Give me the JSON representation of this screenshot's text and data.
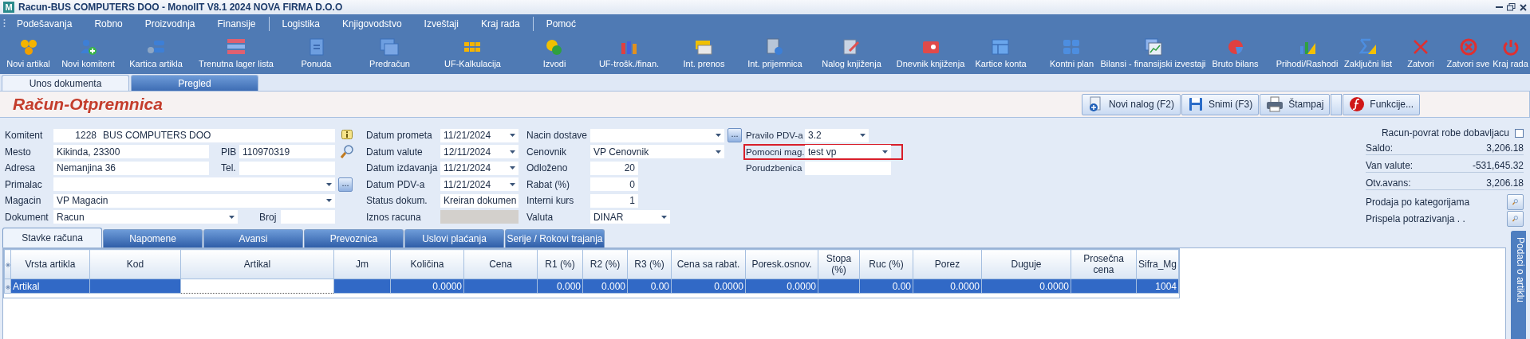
{
  "window": {
    "app_icon": "M",
    "title": "Racun-BUS COMPUTERS DOO - MonolIT V8.1 2024 NOVA FIRMA D.O.O"
  },
  "menu": [
    {
      "label": "Podešavanja",
      "separator_before": false
    },
    {
      "label": "Robno",
      "separator_before": false
    },
    {
      "label": "Proizvodnja",
      "separator_before": false
    },
    {
      "label": "Finansije",
      "separator_before": false
    },
    {
      "label": "Logistika",
      "separator_before": true
    },
    {
      "label": "Knjigovodstvo",
      "separator_before": false
    },
    {
      "label": "Izveštaji",
      "separator_before": false
    },
    {
      "label": "Kraj rada",
      "separator_before": false
    },
    {
      "label": "Pomoć",
      "separator_before": true
    }
  ],
  "toolbar": [
    {
      "label": "Novi artikal"
    },
    {
      "label": "Novi komitent"
    },
    {
      "label": "Kartica artikla"
    },
    {
      "label": "Trenutna lager lista"
    },
    {
      "label": "Ponuda"
    },
    {
      "label": "Predračun"
    },
    {
      "label": "UF-Kalkulacija"
    },
    {
      "label": "Izvodi"
    },
    {
      "label": "UF-trošk./finan."
    },
    {
      "label": "Int. prenos"
    },
    {
      "label": "Int. prijemnica"
    },
    {
      "label": "Nalog knjiženja"
    },
    {
      "label": "Dnevnik knjiženja"
    },
    {
      "label": "Kartice konta"
    },
    {
      "label": "Kontni plan"
    },
    {
      "label": "Bilansi - finansijski izvestaji"
    },
    {
      "label": "Bruto bilans"
    },
    {
      "label": "Prihodi/Rashodi"
    },
    {
      "label": "Zaključni list"
    },
    {
      "label": "Zatvori"
    },
    {
      "label": "Zatvori sve"
    },
    {
      "label": "Kraj rada"
    }
  ],
  "tabs": [
    {
      "label": "Unos dokumenta",
      "selected": true
    },
    {
      "label": "Pregled",
      "selected": false
    }
  ],
  "document": {
    "title": "Račun-Otpremnica",
    "buttons": [
      {
        "label": "Novi nalog (F2)",
        "dropdown": false
      },
      {
        "label": "Snimi (F3)",
        "dropdown": false
      },
      {
        "label": "Štampaj",
        "dropdown": true
      },
      {
        "label": "Funkcije...",
        "dropdown": false
      }
    ]
  },
  "form": {
    "columns": [
      [
        {
          "label": "Komitent",
          "kind": "code",
          "code": "1228",
          "value": "BUS COMPUTERS DOO"
        },
        {
          "label": "Mesto",
          "kind": "pair",
          "value": "Kikinda, 23300",
          "extra_label": "PIB",
          "extra_value": "110970319"
        },
        {
          "label": "Adresa",
          "kind": "pair",
          "value": "Nemanjina 36",
          "extra_label": "Tel."
        },
        {
          "label": "Primalac",
          "kind": "combo",
          "button": "..."
        },
        {
          "label": "Magacin",
          "kind": "combo",
          "value": "VP Magacin"
        },
        {
          "label": "Dokument",
          "kind": "combo_pair",
          "value": "Racun",
          "extra_label": "Broj"
        }
      ],
      [
        {
          "label": "Datum prometa",
          "kind": "combo",
          "value": "11/21/2024",
          "disabled": false
        },
        {
          "label": "Datum valute",
          "kind": "combo",
          "value": "12/11/2024",
          "disabled": false
        },
        {
          "label": "Datum izdavanja",
          "kind": "combo",
          "value": "11/21/2024",
          "disabled": false
        },
        {
          "label": "Datum PDV-a",
          "kind": "combo",
          "value": "11/21/2024",
          "disabled": false
        },
        {
          "label": "Status dokum.",
          "kind": "combo",
          "value": "Kreiran dokumen",
          "disabled": false
        },
        {
          "label": "Iznos racuna",
          "kind": "text",
          "disabled": true
        }
      ],
      [
        {
          "label": "Nacin dostave",
          "kind": "combo",
          "button": "..."
        },
        {
          "label": "Cenovnik",
          "kind": "combo",
          "value": "VP Cenovnik"
        },
        {
          "label": "Odloženo",
          "kind": "number",
          "value": "20"
        },
        {
          "label": "Rabat (%)",
          "kind": "number",
          "value": "0"
        },
        {
          "label": "Interni kurs",
          "kind": "number",
          "value": "1"
        },
        {
          "label": "Valuta",
          "kind": "combo_short",
          "value": "DINAR"
        }
      ],
      [
        {
          "label": "Pravilo PDV-a",
          "kind": "combo",
          "value": "3.2",
          "highlighted": false
        },
        {
          "label": "Pomocni mag.",
          "kind": "combo",
          "value": "test vp",
          "highlighted": true
        },
        {
          "label": "Porudzbenica",
          "kind": "text",
          "highlighted": false
        }
      ]
    ]
  },
  "summary": {
    "checkbox": {
      "label": "Racun-povrat robe dobavljacu",
      "checked": false
    },
    "totals": [
      {
        "label": "Saldo:",
        "value": "3,206.18"
      },
      {
        "label": "Van valute:",
        "value": "-531,645.32"
      },
      {
        "label": "Otv.avans:",
        "value": "3,206.18"
      }
    ],
    "lookups": [
      {
        "label": "Prodaja po kategorijama"
      },
      {
        "label": "Prispela potrazivanja . ."
      }
    ]
  },
  "item_tabs": [
    {
      "label": "Stavke računa",
      "selected": true
    },
    {
      "label": "Napomene",
      "selected": false
    },
    {
      "label": "Avansi",
      "selected": false
    },
    {
      "label": "Prevoznica",
      "selected": false
    },
    {
      "label": "Uslovi plaćanja",
      "selected": false
    },
    {
      "label": "Serije / Rokovi trajanja",
      "selected": false
    }
  ],
  "grid": {
    "columns": [
      "Vrsta artikla",
      "Kod",
      "Artikal",
      "Jm",
      "Količina",
      "Cena",
      "R1 (%)",
      "R2 (%)",
      "R3 (%)",
      "Cena sa rabat.",
      "Poresk.osnov.",
      "Stopa (%)",
      "Ruc (%)",
      "Porez",
      "Duguje",
      "Prosečna cena",
      "Sifra_Mg"
    ],
    "rows": [
      {
        "selected": true,
        "cells": [
          {
            "text": "Artikal",
            "editing": false
          },
          {
            "editing": false
          },
          {
            "editing": true
          },
          {
            "editing": false
          },
          {
            "text": "0.0000",
            "editing": false
          },
          {
            "editing": false
          },
          {
            "text": "0.000",
            "editing": false
          },
          {
            "text": "0.000",
            "editing": false
          },
          {
            "text": "0.00",
            "editing": false
          },
          {
            "text": "0.0000",
            "editing": false
          },
          {
            "text": "0.0000",
            "editing": false
          },
          {
            "editing": false
          },
          {
            "text": "0.00",
            "editing": false
          },
          {
            "text": "0.0000",
            "editing": false
          },
          {
            "text": "0.0000",
            "editing": false
          },
          {
            "editing": false
          },
          {
            "text": "1004",
            "editing": false
          }
        ]
      }
    ]
  },
  "side_tab": {
    "label": "Podaci o artiklu"
  }
}
